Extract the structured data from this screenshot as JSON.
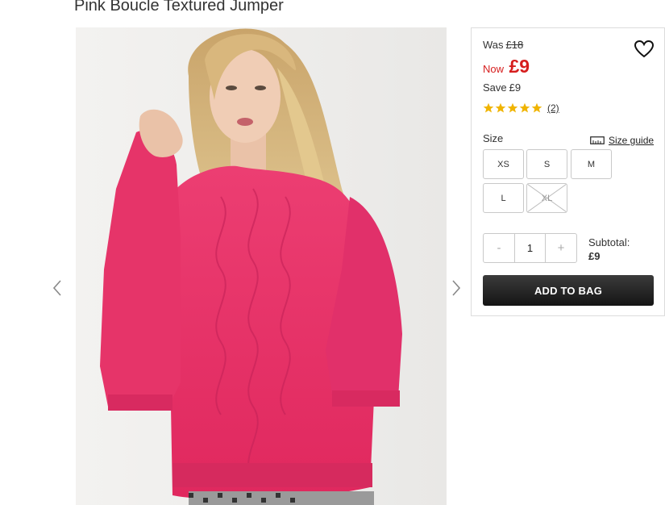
{
  "product": {
    "title": "Pink Boucle Textured Jumper"
  },
  "gallery": {
    "image_alt": "Model wearing pink boucle textured jumper",
    "prev_icon": "chevron-left-icon",
    "next_icon": "chevron-right-icon"
  },
  "price": {
    "was_label": "Was",
    "was_value": "£18",
    "now_label": "Now",
    "now_value": "£9",
    "save_label": "Save",
    "save_value": "£9",
    "accent_color": "#d61e1e"
  },
  "rating": {
    "stars": 5,
    "max": 5,
    "count_text": "(2)",
    "star_color": "#f0b400"
  },
  "size": {
    "label": "Size",
    "guide_label": "Size guide",
    "options": [
      {
        "label": "XS",
        "available": true
      },
      {
        "label": "S",
        "available": true
      },
      {
        "label": "M",
        "available": true
      },
      {
        "label": "L",
        "available": true
      },
      {
        "label": "XL",
        "available": false
      }
    ]
  },
  "quantity": {
    "minus": "-",
    "value": "1",
    "plus": "+"
  },
  "subtotal": {
    "label": "Subtotal:",
    "value": "£9"
  },
  "actions": {
    "add_to_bag": "ADD TO BAG",
    "wishlist_icon": "heart-icon"
  }
}
